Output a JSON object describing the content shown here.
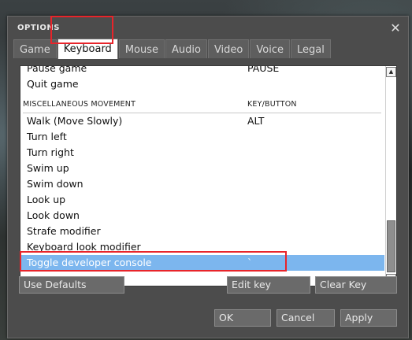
{
  "dialog": {
    "title": "OPTIONS",
    "close_glyph": "✕"
  },
  "tabs": [
    {
      "label": "Game"
    },
    {
      "label": "Keyboard"
    },
    {
      "label": "Mouse"
    },
    {
      "label": "Audio"
    },
    {
      "label": "Video"
    },
    {
      "label": "Voice"
    },
    {
      "label": "Legal"
    }
  ],
  "active_tab": "Keyboard",
  "list": {
    "pause_game": {
      "action": "Pause game",
      "key": "PAUSE"
    },
    "quit_game": {
      "action": "Quit game",
      "key": ""
    },
    "section_header": {
      "action": "MISCELLANEOUS MOVEMENT",
      "key": "KEY/BUTTON"
    },
    "items": [
      {
        "action": "Walk (Move Slowly)",
        "key": "ALT"
      },
      {
        "action": "Turn left",
        "key": ""
      },
      {
        "action": "Turn right",
        "key": ""
      },
      {
        "action": "Swim up",
        "key": ""
      },
      {
        "action": "Swim down",
        "key": ""
      },
      {
        "action": "Look up",
        "key": ""
      },
      {
        "action": "Look down",
        "key": ""
      },
      {
        "action": "Strafe modifier",
        "key": ""
      },
      {
        "action": "Keyboard look modifier",
        "key": ""
      },
      {
        "action": "Toggle developer console",
        "key": "`"
      }
    ],
    "selected": "Toggle developer console"
  },
  "scrollbar": {
    "up_glyph": "▲",
    "down_glyph": "▼"
  },
  "buttons": {
    "use_defaults": "Use Defaults",
    "edit_key": "Edit key",
    "clear_key": "Clear Key",
    "ok": "OK",
    "cancel": "Cancel",
    "apply": "Apply"
  },
  "colors": {
    "selection": "#7cb6ee",
    "highlight_box": "#e8242a"
  }
}
